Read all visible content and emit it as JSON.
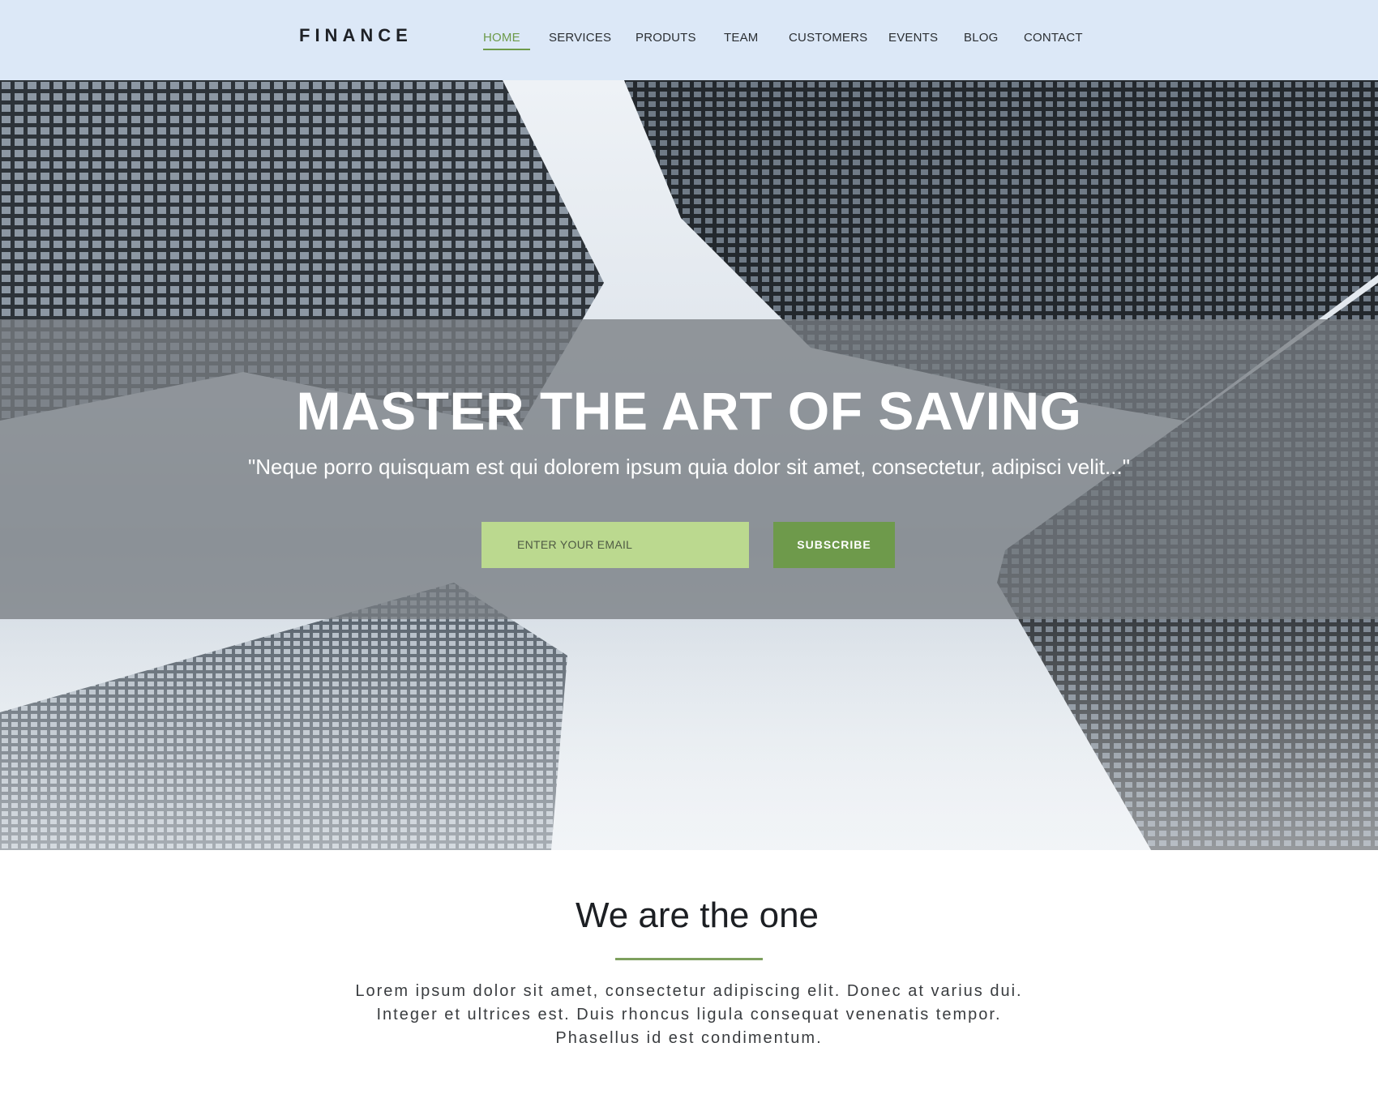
{
  "header": {
    "logo": "FINANCE",
    "nav": [
      "HOME",
      "SERVICES",
      "PRODUTS",
      "TEAM",
      "CUSTOMERS",
      "EVENTS",
      "BLOG",
      "CONTACT"
    ],
    "active_nav": "HOME"
  },
  "hero": {
    "title": "MASTER THE ART OF SAVING",
    "subtitle": "\"Neque porro quisquam est qui dolorem ipsum quia dolor sit amet, consectetur, adipisci velit...\"",
    "email_placeholder": "ENTER YOUR EMAIL",
    "subscribe_label": "SUBSCRIBE"
  },
  "about": {
    "title": "We are the one",
    "lines": [
      "Lorem ipsum dolor sit amet, consectetur adipiscing elit. Donec at varius dui.",
      "Integer et ultrices est. Duis rhoncus ligula consequat venenatis tempor.",
      "Phasellus id est condimentum."
    ]
  },
  "colors": {
    "header_bg": "#dce8f7",
    "accent_green": "#6e9a4b",
    "input_green": "#bbd98f",
    "overlay": "#7c8187"
  }
}
